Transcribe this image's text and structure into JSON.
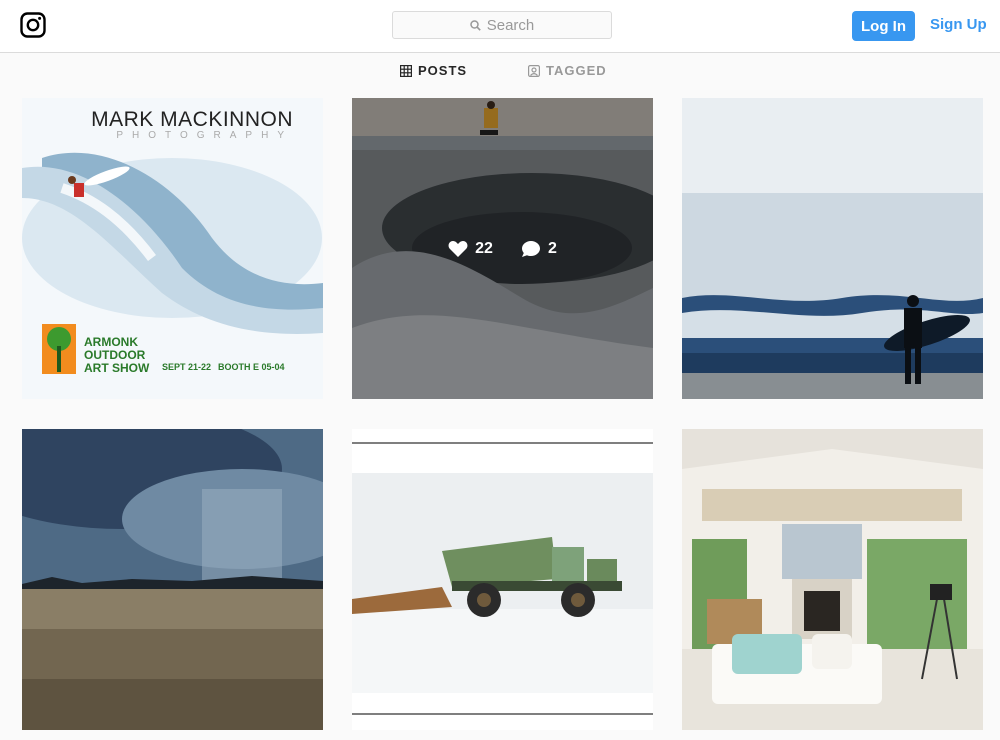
{
  "header": {
    "search_placeholder": "Search",
    "login_label": "Log In",
    "signup_label": "Sign Up"
  },
  "tabs": [
    {
      "label": "POSTS",
      "icon": "grid-icon",
      "active": true
    },
    {
      "label": "TAGGED",
      "icon": "tagged-icon",
      "active": false
    }
  ],
  "posts": [
    {
      "subject": "surfer on wave poster",
      "poster": {
        "title": "MARK MACKINNON",
        "subtitle": "PHOTOGRAPHY",
        "show_lines": [
          "ARMONK",
          "OUTDOOR",
          "ART SHOW"
        ],
        "dates": "SEPT 21-22",
        "booth": "BOOTH E 05-04"
      }
    },
    {
      "subject": "skateboarder above skate bowl",
      "hover": {
        "likes": "22",
        "comments": "2"
      }
    },
    {
      "subject": "surfer with board before breaking waves"
    },
    {
      "subject": "storm over flat plain"
    },
    {
      "subject": "dump truck in snow"
    },
    {
      "subject": "living room with white sofa"
    }
  ],
  "colors": {
    "accent": "#3897f0",
    "active_tab": "#262626",
    "inactive_tab": "#999999"
  }
}
